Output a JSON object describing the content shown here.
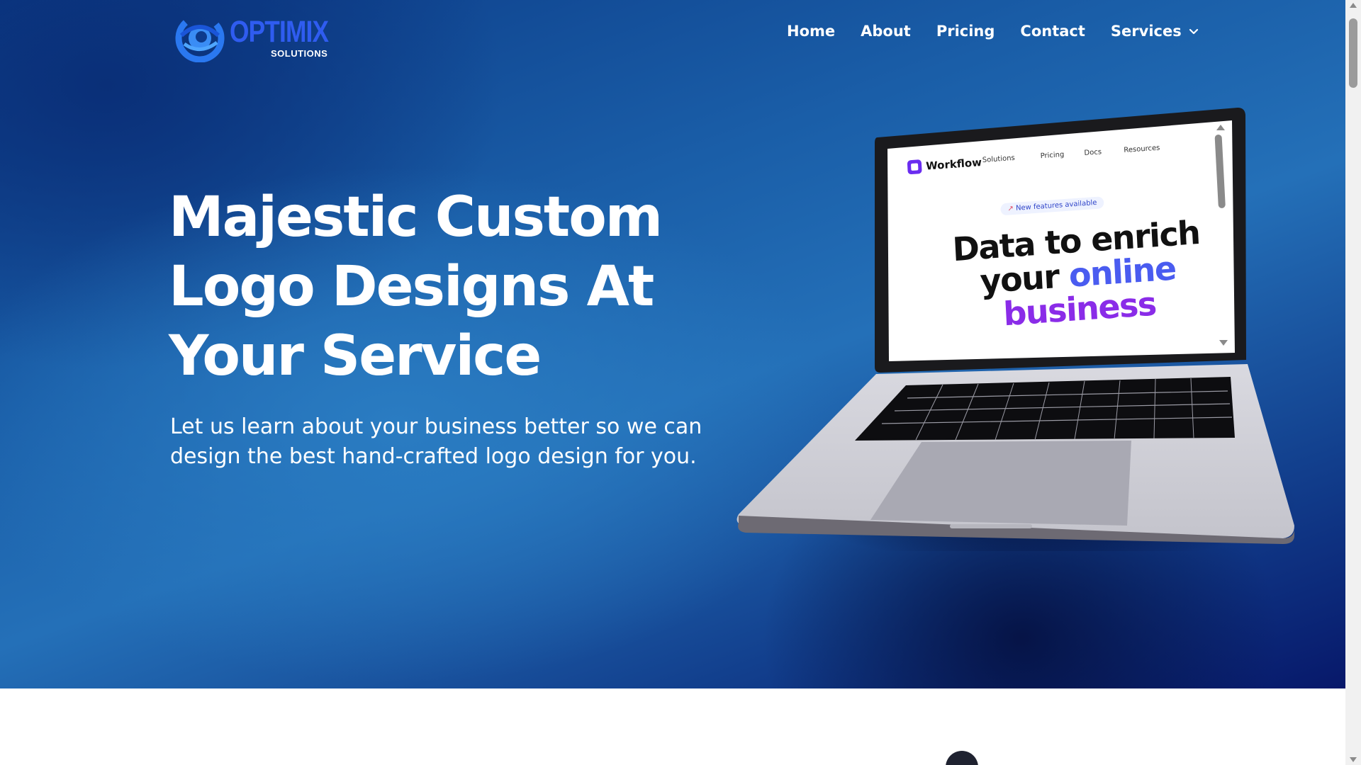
{
  "brand": {
    "name": "OPTIMIX",
    "tagline": "SOLUTIONS",
    "logo_icon": "swirl-eye-icon",
    "colors": {
      "primary": "#2f5cf0",
      "accent": "#1e6fe0"
    }
  },
  "nav": {
    "items": [
      {
        "label": "Home"
      },
      {
        "label": "About"
      },
      {
        "label": "Pricing"
      },
      {
        "label": "Contact"
      },
      {
        "label": "Services",
        "icon": "chevron-down-icon"
      }
    ]
  },
  "hero": {
    "headline_lines": [
      "Majestic Custom",
      "Logo Designs At",
      "Your Service"
    ],
    "subtext_lines": [
      "Let us learn about your business better so we can",
      "design the best hand-crafted logo design for you."
    ],
    "background": {
      "from": "#0b3a86",
      "mid": "#2470b8",
      "to": "#07186a"
    }
  },
  "laptop_screen": {
    "brand": "Workflow",
    "nav": [
      "Solutions",
      "Pricing",
      "Docs",
      "Resources"
    ],
    "pill": "New features available",
    "pill_icon": "rocket-icon",
    "headline": {
      "line1": "Data to enrich",
      "line2a": "your ",
      "line2b": "online",
      "line3": "business"
    },
    "colors": {
      "blue": "#4a5cf0",
      "purple": "#8a2ce8"
    }
  }
}
